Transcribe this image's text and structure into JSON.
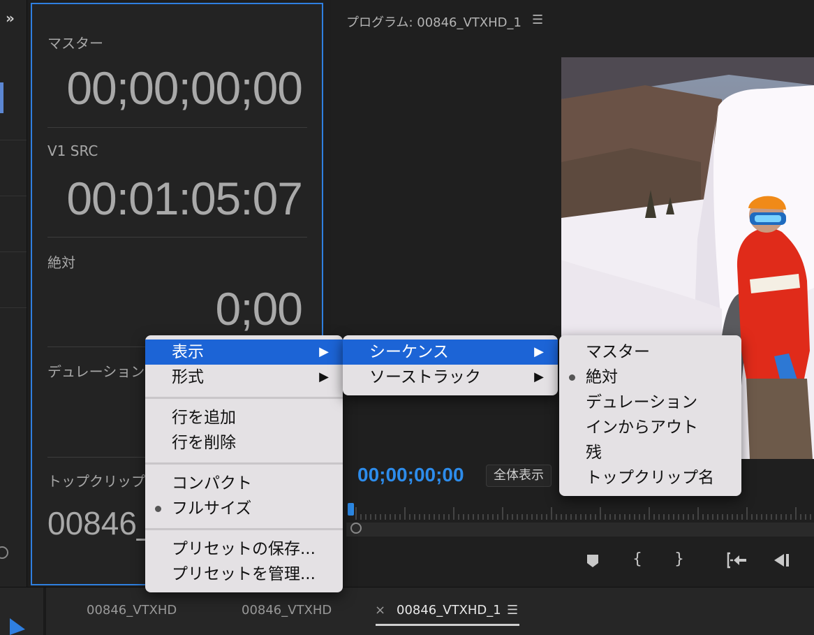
{
  "left_strip": {
    "expand_icon": "»"
  },
  "timecode_panel": {
    "rows": [
      {
        "label": "マスター",
        "value": "00;00;00;00"
      },
      {
        "label": "V1 SRC",
        "value": "00:01:05:07"
      },
      {
        "label": "絶対",
        "value": "0;00"
      },
      {
        "label": "デュレーション",
        "value": ""
      },
      {
        "label": "トップクリップ名",
        "value": "00846_VTXHD_1"
      }
    ]
  },
  "program_monitor": {
    "title": "プログラム: 00846_VTXHD_1",
    "menu_icon": "☰",
    "timecode": "00;00;00;00",
    "fit_label": "全体表示",
    "controls": [
      "marker-icon",
      "mark-in-icon",
      "mark-out-icon",
      "go-to-in-icon",
      "step-back-icon"
    ]
  },
  "context_menu": {
    "main": [
      {
        "label": "表示",
        "submenu": true,
        "highlighted": true
      },
      {
        "label": "形式",
        "submenu": true
      },
      {
        "label": "行を追加"
      },
      {
        "label": "行を削除"
      },
      {
        "label": "コンパクト"
      },
      {
        "label": "フルサイズ",
        "checked": true
      },
      {
        "label": "プリセットの保存..."
      },
      {
        "label": "プリセットを管理..."
      }
    ],
    "display_submenu": [
      {
        "label": "シーケンス",
        "submenu": true,
        "highlighted": true
      },
      {
        "label": "ソーストラック",
        "submenu": true
      }
    ],
    "sequence_submenu": [
      {
        "label": "マスター"
      },
      {
        "label": "絶対",
        "checked": true
      },
      {
        "label": "デュレーション"
      },
      {
        "label": "インからアウト"
      },
      {
        "label": "残"
      },
      {
        "label": "トップクリップ名"
      }
    ],
    "submenu_arrow": "▶"
  },
  "tabs": [
    {
      "label": "00846_VTXHD"
    },
    {
      "label": "00846_VTXHD"
    },
    {
      "label": "00846_VTXHD_1",
      "active": true,
      "close_icon": "×",
      "menu_icon": "☰"
    }
  ],
  "colors": {
    "accent": "#2f7fe0",
    "timecode_blue": "#2d8ceb",
    "menu_highlight": "#1c64d6"
  }
}
